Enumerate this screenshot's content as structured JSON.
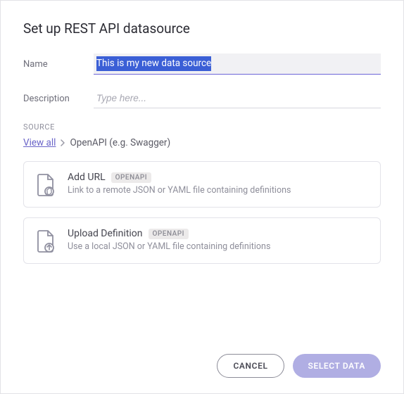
{
  "title": "Set up REST API datasource",
  "fields": {
    "name_label": "Name",
    "name_value": "This is my new data source",
    "desc_label": "Description",
    "desc_placeholder": "Type here..."
  },
  "source": {
    "section_label": "SOURCE",
    "view_all": "View all",
    "breadcrumb": "OpenAPI (e.g. Swagger)"
  },
  "options": [
    {
      "title": "Add URL",
      "badge": "OPENAPI",
      "desc": "Link to a remote JSON or YAML file containing definitions"
    },
    {
      "title": "Upload Definition",
      "badge": "OPENAPI",
      "desc": "Use a local JSON or YAML file containing definitions"
    }
  ],
  "buttons": {
    "cancel": "CANCEL",
    "select": "SELECT DATA"
  }
}
